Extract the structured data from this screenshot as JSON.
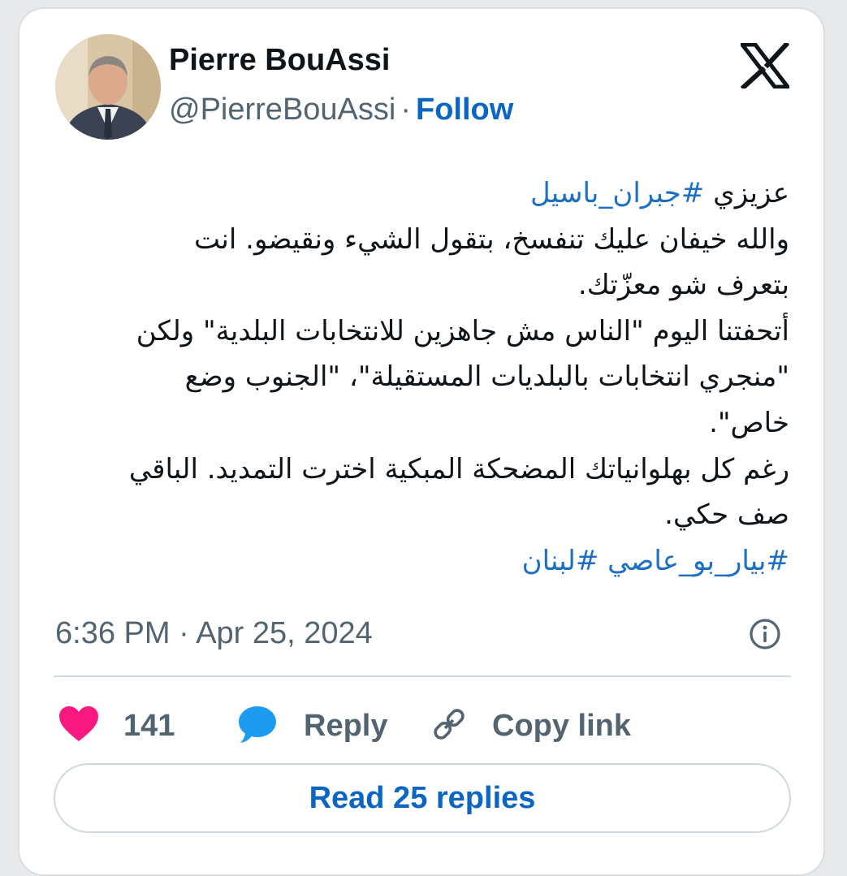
{
  "author": {
    "name": "Pierre BouAssi",
    "handle": "@PierreBouAssi",
    "separator": "·",
    "follow_label": "Follow"
  },
  "tweet": {
    "line1_text": "عزيزي ",
    "line1_hashtag": "#جبران_باسيل",
    "line2": "والله خيفان عليك تنفسخ، بتقول الشيء ونقيضو. انت",
    "line3": "بتعرف شو معزّتك.",
    "line4": "أتحفتنا اليوم \"الناس مش جاهزين للانتخابات البلدية\" ولكن",
    "line5": "\"منجري انتخابات بالبلديات المستقيلة\"، \"الجنوب وضع",
    "line6": "خاص\".",
    "line7": "رغم كل بهلوانياتك المضحكة المبكية اخترت التمديد. الباقي",
    "line8": "صف حكي.",
    "hashtags": [
      "#بيار_بو_عاصي",
      "#لبنان"
    ],
    "timestamp": "6:36 PM · Apr 25, 2024"
  },
  "actions": {
    "like_count": "141",
    "reply_label": "Reply",
    "copy_link_label": "Copy link"
  },
  "read_replies_label": "Read 25 replies",
  "colors": {
    "accent": "#0a66c2",
    "hashtag": "#1d6fc4",
    "like": "#f91880",
    "reply_icon": "#1d9bf0",
    "secondary_text": "#536471"
  },
  "icons": {
    "brand": "x-logo-icon",
    "info": "info-icon",
    "like": "heart-icon",
    "reply": "speech-bubble-icon",
    "copy": "link-icon"
  }
}
